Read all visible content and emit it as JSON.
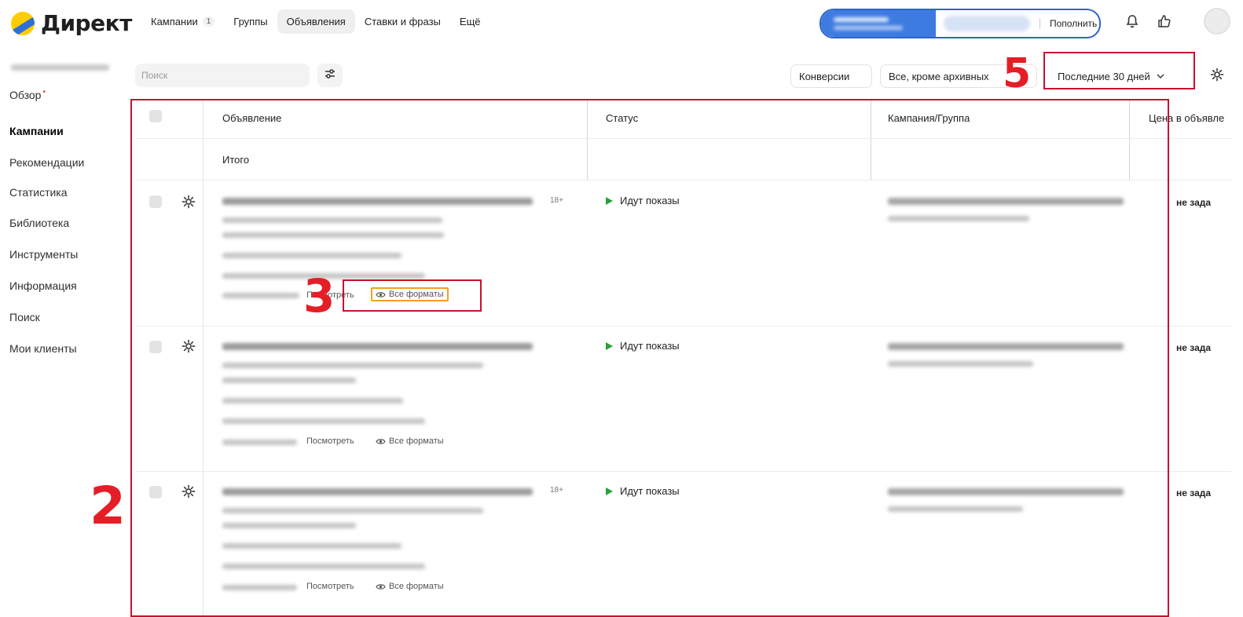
{
  "logo": {
    "text": "Директ"
  },
  "topnav": [
    {
      "label": "Кампании",
      "count": "1"
    },
    {
      "label": "Группы"
    },
    {
      "label": "Объявления",
      "active": true
    },
    {
      "label": "Ставки и фразы"
    },
    {
      "label": "Ещё"
    }
  ],
  "budget": {
    "topup_label": "Пополнить"
  },
  "icons": {
    "bell": "bell-icon",
    "like": "thumbs-up-icon",
    "avatar": "user-avatar",
    "settings": "gear-icon",
    "filter": "sliders-icon",
    "eye": "eye-icon"
  },
  "sidebar": {
    "items": [
      {
        "label": "Обзор",
        "badge": "•"
      },
      {
        "label": "Кампании",
        "active": true
      },
      {
        "label": "Рекомендации"
      },
      {
        "label": "Статистика"
      },
      {
        "label": "Библиотека"
      },
      {
        "label": "Инструменты"
      },
      {
        "label": "Информация"
      },
      {
        "label": "Поиск"
      },
      {
        "label": "Мои клиенты"
      }
    ]
  },
  "toolbar": {
    "search_placeholder": "Поиск",
    "conversions": "Конверсии",
    "archive_filter": "Все, кроме архивных",
    "period": "Последние 30 дней"
  },
  "table": {
    "headers": {
      "ad": "Объявление",
      "status": "Статус",
      "campaign": "Кампания/Группа",
      "price": "Цена в объявле"
    },
    "total_label": "Итого",
    "rows": [
      {
        "age": "18+",
        "status": "Идут показы",
        "price": "не зада",
        "view": "Посмотреть",
        "formats": "Все форматы"
      },
      {
        "age": "",
        "status": "Идут показы",
        "price": "не зада",
        "view": "Посмотреть",
        "formats": "Все форматы"
      },
      {
        "age": "18+",
        "status": "Идут показы",
        "price": "не зада",
        "view": "Посмотреть",
        "formats": "Все форматы"
      }
    ]
  },
  "annotations": {
    "n2": "2",
    "n3": "3",
    "n5": "5"
  },
  "colors": {
    "accent_blue": "#3d7be0",
    "status_green": "#2aa13a",
    "annotation_red": "#e41e26",
    "highlight_orange": "#f0a029"
  }
}
